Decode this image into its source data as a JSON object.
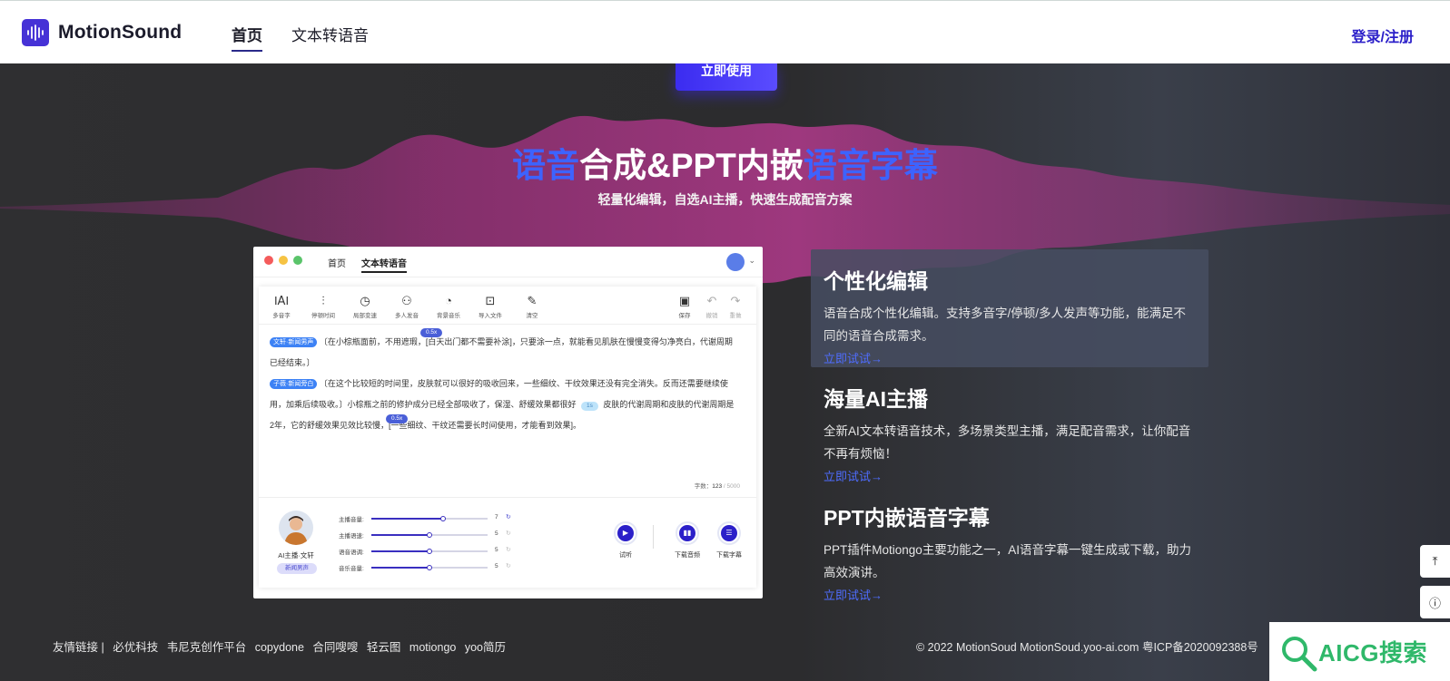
{
  "nav": {
    "brand": "MotionSound",
    "links": [
      "首页",
      "文本转语音"
    ],
    "login": "登录/注册"
  },
  "hero": {
    "cta": "立即使用",
    "title_parts": [
      "语音",
      "合成&PPT内嵌",
      "语音字幕"
    ],
    "subtitle": "轻量化编辑，自选AI主播，快速生成配音方案"
  },
  "preview": {
    "tabs": [
      "首页",
      "文本转语音"
    ],
    "tools": [
      "多音字",
      "停顿时间",
      "局部变速",
      "多人发音",
      "背景音乐",
      "导入文件",
      "清空"
    ],
    "tools_right": [
      "保存",
      "撤销",
      "重做"
    ],
    "editor": {
      "tag1": "文轩·新闻男声",
      "line1a": "〔在小棕瓶面前，不用遮瑕，",
      "line1b": "[白天出门都不需要补涂]",
      "line1c": "，只要涂一点，就能看见肌肤在慢慢变得匀净亮白，代谢周期",
      "line1d": "已经结束。〕",
      "tag2": "子薇·新闻旁白",
      "line2a": "〔在这个比较短的时间里，皮肤就可以很好的吸收回来，一些细纹、干纹效果还没有完全消失。反而还需要继续使",
      "line2b": "用，加乘后续吸收。〕小棕瓶之前的修护成分已经全部吸收了，保湿、舒缓效果都很好",
      "line2c": "皮肤的代谢周期和皮肤的代谢周期是",
      "line2d": "2年，它的舒缓效果见效比较慢，",
      "line2e": "[一些细纹、干纹还需要长时间使用，才能看到效果]",
      "line2f": "。",
      "badge1": "0.5x",
      "badge2": "1s",
      "badge3": "0.5x",
      "count_label": "字数：",
      "count_value": "123",
      "count_max": "/ 5000"
    },
    "host": {
      "name": "AI主播·文轩",
      "tag": "新闻男声"
    },
    "sliders": [
      {
        "label": "主播音量:",
        "value": "7",
        "level": 0.62
      },
      {
        "label": "主播语速:",
        "value": "5",
        "level": 0.5
      },
      {
        "label": "语音语调:",
        "value": "5",
        "level": 0.5
      },
      {
        "label": "音乐音量:",
        "value": "5",
        "level": 0.5
      }
    ],
    "actions": [
      "试听",
      "下载音频",
      "下载字幕"
    ]
  },
  "features": [
    {
      "title": "个性化编辑",
      "desc": "语音合成个性化编辑。支持多音字/停顿/多人发声等功能，能满足不同的语音合成需求。",
      "link": "立即试试→"
    },
    {
      "title": "海量AI主播",
      "desc": "全新AI文本转语音技术，多场景类型主播，满足配音需求，让你配音不再有烦恼！",
      "link": "立即试试→"
    },
    {
      "title": "PPT内嵌语音字幕",
      "desc": "PPT插件Motiongo主要功能之一，AI语音字幕一键生成或下载，助力高效演讲。",
      "link": "立即试试→"
    }
  ],
  "footer": {
    "label": "友情链接 |",
    "links": [
      "必优科技",
      "韦尼克创作平台",
      "copydone",
      "合同嗖嗖",
      "轻云图",
      "motiongo",
      "yoo简历"
    ],
    "copyright": "© 2022 MotionSoud MotionSoud.yoo-ai.com 粤ICP备2020092388号"
  },
  "watermark": "AICG搜索",
  "colors": {
    "accent": "#2b1fc9",
    "title_blue": "#3d63ff",
    "link_blue": "#4f6dff"
  }
}
